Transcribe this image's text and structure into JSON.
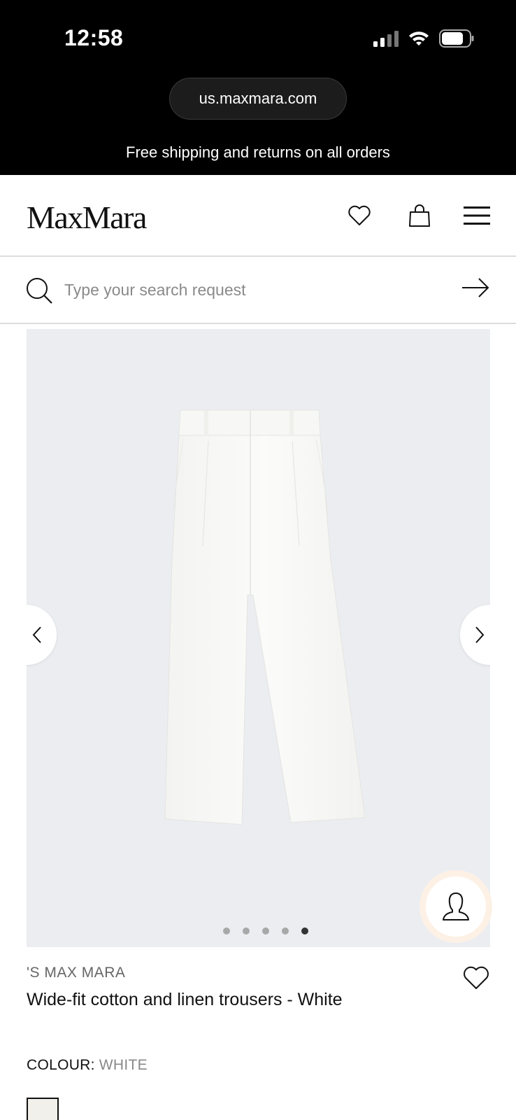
{
  "status_bar": {
    "time": "12:58"
  },
  "browser": {
    "url": "us.maxmara.com"
  },
  "promo_banner": "Free shipping and returns on all orders",
  "header": {
    "logo": "MaxMara"
  },
  "search": {
    "placeholder": "Type your search request",
    "value": ""
  },
  "gallery": {
    "image_count": 5,
    "active_index": 4,
    "background": "#ebedf1"
  },
  "product": {
    "brand": "'S MAX MARA",
    "name": "Wide-fit cotton and linen trousers - White",
    "colour_label": "COLOUR:",
    "colour_value": "WHITE",
    "swatch_color": "#f1f0ea"
  },
  "icons": {
    "header": [
      "heart-icon",
      "shopping-bag-icon",
      "menu-icon"
    ],
    "search": [
      "search-icon",
      "arrow-right-icon"
    ],
    "gallery": [
      "chevron-left-icon",
      "chevron-right-icon",
      "person-icon"
    ],
    "product": [
      "heart-icon"
    ]
  }
}
